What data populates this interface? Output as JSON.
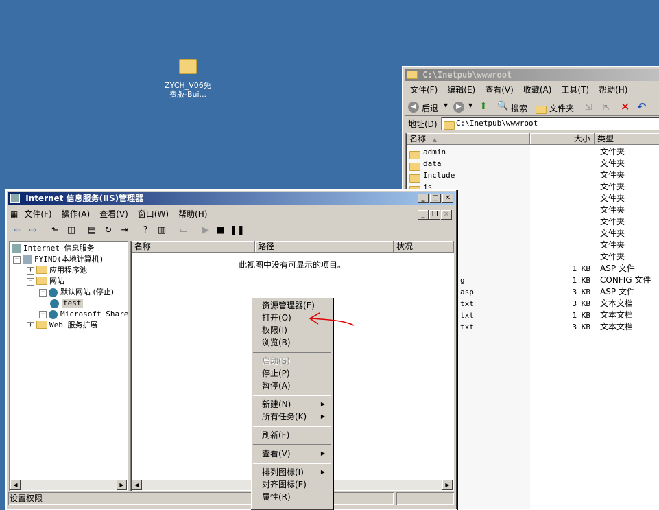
{
  "desktop": {
    "icon_label_1": "ZYCH_V06免",
    "icon_label_2": "费版-Bui..."
  },
  "explorer": {
    "title": "C:\\Inetpub\\wwwroot",
    "menu": [
      "文件(F)",
      "编辑(E)",
      "查看(V)",
      "收藏(A)",
      "工具(T)",
      "帮助(H)"
    ],
    "toolbar": {
      "back": "后退",
      "search": "搜索",
      "folders": "文件夹"
    },
    "address_label": "地址(D)",
    "address_value": "C:\\Inetpub\\wwwroot",
    "columns": {
      "name": "名称",
      "size": "大小",
      "type": "类型"
    },
    "files": [
      {
        "name": "admin",
        "size": "",
        "type": "文件夹"
      },
      {
        "name": "data",
        "size": "",
        "type": "文件夹"
      },
      {
        "name": "Include",
        "size": "",
        "type": "文件夹"
      },
      {
        "name": "js",
        "size": "",
        "type": "文件夹"
      },
      {
        "name": "",
        "size": "",
        "type": "文件夹"
      },
      {
        "name": "",
        "size": "",
        "type": "文件夹"
      },
      {
        "name": "",
        "size": "",
        "type": "文件夹"
      },
      {
        "name": "",
        "size": "",
        "type": "文件夹"
      },
      {
        "name": "",
        "size": "",
        "type": "文件夹"
      },
      {
        "name": "",
        "size": "",
        "type": "文件夹"
      },
      {
        "name": "",
        "size": "1 KB",
        "type": "ASP 文件"
      },
      {
        "name": "g",
        "size": "1 KB",
        "type": "CONFIG 文件"
      },
      {
        "name": "asp",
        "size": "3 KB",
        "type": "ASP 文件"
      },
      {
        "name": "txt",
        "size": "3 KB",
        "type": "文本文档"
      },
      {
        "name": "txt",
        "size": "1 KB",
        "type": "文本文档"
      },
      {
        "name": "txt",
        "size": "3 KB",
        "type": "文本文档"
      }
    ]
  },
  "iis": {
    "title": "Internet 信息服务(IIS)管理器",
    "menu": [
      "文件(F)",
      "操作(A)",
      "查看(V)",
      "窗口(W)",
      "帮助(H)"
    ],
    "tree": {
      "root": "Internet 信息服务",
      "computer": "FYIND(本地计算机)",
      "app_pools": "应用程序池",
      "websites": "网站",
      "default_site": "默认网站 (停止)",
      "test": "test",
      "sharepoint": "Microsoft Share",
      "web_ext": "Web 服务扩展"
    },
    "columns": {
      "name": "名称",
      "path": "路径",
      "status": "状况"
    },
    "empty_message": "此视图中没有可显示的项目。",
    "status_text": "设置权限"
  },
  "context_menu": {
    "items": [
      {
        "label": "资源管理器(E)",
        "enabled": true
      },
      {
        "label": "打开(O)",
        "enabled": true
      },
      {
        "label": "权限(I)",
        "enabled": true
      },
      {
        "label": "浏览(B)",
        "enabled": true
      },
      {
        "label": "启动(S)",
        "enabled": false
      },
      {
        "label": "停止(P)",
        "enabled": true
      },
      {
        "label": "暂停(A)",
        "enabled": true
      },
      {
        "label": "新建(N)",
        "enabled": true,
        "submenu": true
      },
      {
        "label": "所有任务(K)",
        "enabled": true,
        "submenu": true
      },
      {
        "label": "刷新(F)",
        "enabled": true
      },
      {
        "label": "查看(V)",
        "enabled": true,
        "submenu": true
      },
      {
        "label": "排列图标(I)",
        "enabled": true,
        "submenu": true
      },
      {
        "label": "对齐图标(E)",
        "enabled": true
      },
      {
        "label": "属性(R)",
        "enabled": true
      }
    ]
  },
  "colors": {
    "desktop": "#3a6ea5",
    "annotation": "#e00000",
    "title_active": "#0a246a"
  }
}
